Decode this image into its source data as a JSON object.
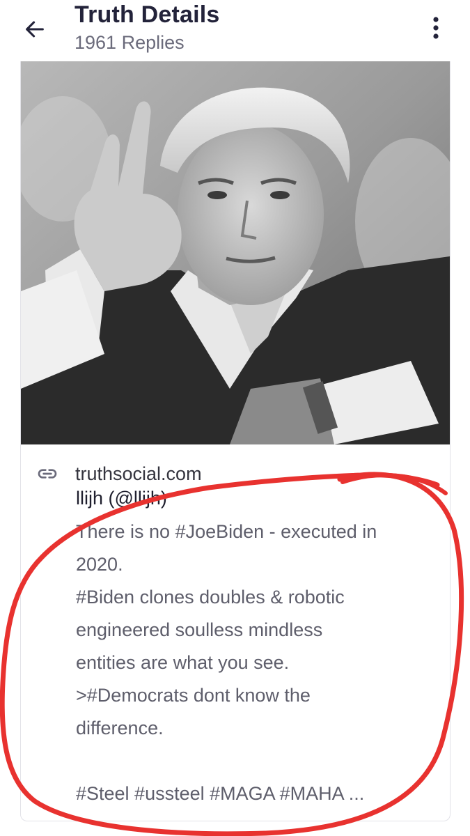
{
  "header": {
    "back_icon": "arrow-left-icon",
    "title": "Truth Details",
    "replies": "1961 Replies",
    "menu_icon": "more-vertical-icon"
  },
  "card": {
    "image_description_icon": "photo",
    "link_icon": "link-icon",
    "domain": "truthsocial.com",
    "author": "llijh (@llijh)",
    "lines": [
      "There is no #JoeBiden - executed in",
      "2020.",
      "#Biden clones doubles & robotic",
      "engineered soulless mindless",
      "entities are what you see.",
      ">#Democrats dont know the",
      "difference.",
      "",
      "#Steel #ussteel #MAGA #MAHA ..."
    ]
  },
  "colors": {
    "title": "#23233a",
    "subtitle": "#6b6b7b",
    "body_text": "#5e5e6b",
    "annotation": "#e8322f",
    "card_border": "#e2e2e8"
  }
}
